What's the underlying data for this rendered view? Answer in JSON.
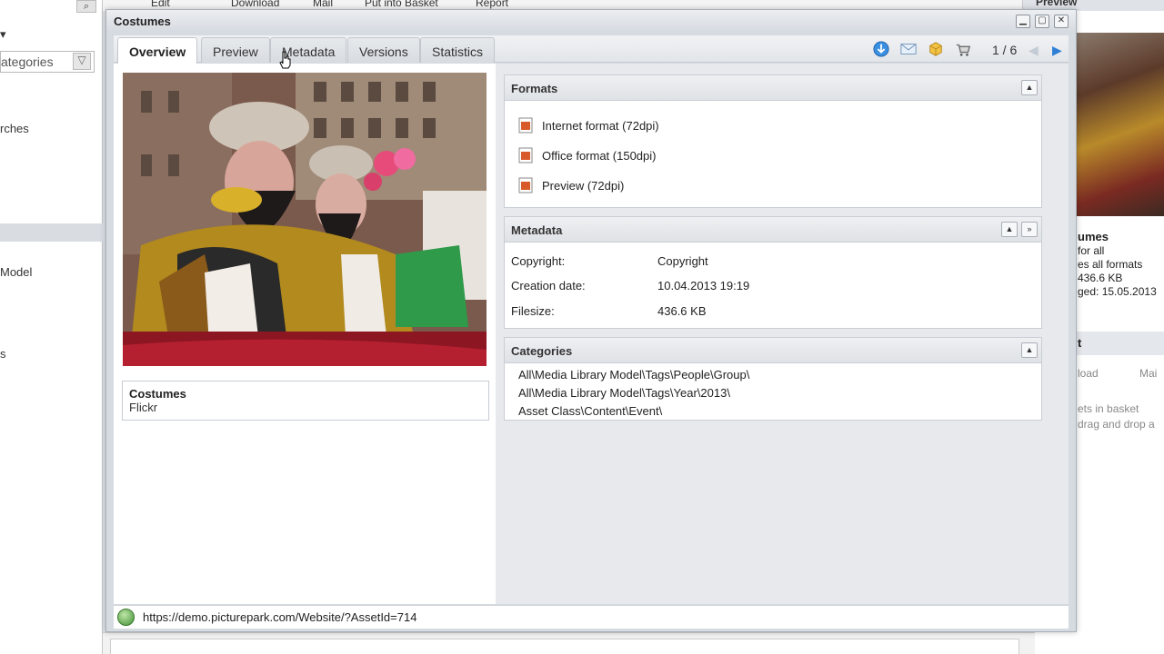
{
  "background": {
    "left_items": [
      "ategories",
      "rches",
      "Model",
      "s"
    ],
    "top_items": [
      "Edit",
      "Download",
      "Mail",
      "Put into Basket",
      "Report"
    ],
    "right_panel": {
      "header": "Preview",
      "title": "umes",
      "lines": [
        "for all",
        "es all formats",
        "436.6 KB",
        "ged: 15.05.2013"
      ],
      "line2": "t",
      "basket_lines": [
        "ets in basket",
        "drag and drop a"
      ],
      "basket_buttons": [
        "load",
        "Mai"
      ]
    }
  },
  "window": {
    "title": "Costumes",
    "controls": [
      "minimize-icon",
      "maximize-icon",
      "close-icon"
    ]
  },
  "tabs": [
    {
      "label": "Overview",
      "active": true
    },
    {
      "label": "Preview",
      "active": false
    },
    {
      "label": "Metadata",
      "active": false
    },
    {
      "label": "Versions",
      "active": false
    },
    {
      "label": "Statistics",
      "active": false
    }
  ],
  "toolbar": {
    "icons": [
      "download-icon",
      "mail-icon",
      "package-icon",
      "basket-icon"
    ],
    "counter": "1 / 6",
    "prev": "previous-arrow-icon",
    "next": "next-arrow-icon"
  },
  "asset": {
    "caption_title": "Costumes",
    "caption_source": "Flickr"
  },
  "formats": {
    "title": "Formats",
    "items": [
      "Internet format (72dpi)",
      "Office format (150dpi)",
      "Preview (72dpi)"
    ]
  },
  "metadata": {
    "title": "Metadata",
    "rows": [
      {
        "key": "Copyright:",
        "value": "Copyright"
      },
      {
        "key": "Creation date:",
        "value": "10.04.2013 19:19"
      },
      {
        "key": "Filesize:",
        "value": "436.6 KB"
      }
    ]
  },
  "categories": {
    "title": "Categories",
    "items": [
      "All\\Media Library Model\\Tags\\People\\Group\\",
      "All\\Media Library Model\\Tags\\Year\\2013\\",
      "Asset Class\\Content\\Event\\"
    ]
  },
  "status": {
    "url": "https://demo.picturepark.com/Website/?AssetId=714"
  },
  "colors": {
    "accent_blue": "#2f7fd6",
    "panel_header": "#dfe2e6",
    "window_bg": "#d6dbe1"
  }
}
